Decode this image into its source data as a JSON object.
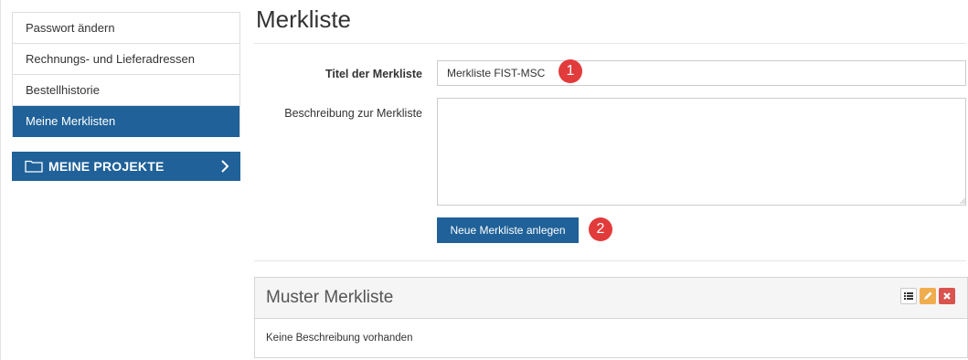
{
  "sidebar": {
    "items": [
      {
        "label": "Passwort ändern",
        "active": false
      },
      {
        "label": "Rechnungs- und Lieferadressen",
        "active": false
      },
      {
        "label": "Bestellhistorie",
        "active": false
      },
      {
        "label": "Meine Merklisten",
        "active": true
      }
    ],
    "projects_button": {
      "label": "MEINE PROJEKTE",
      "icon": "folder-icon",
      "chevron": "chevron-right-icon"
    }
  },
  "main": {
    "title": "Merkliste",
    "form": {
      "title_label": "Titel der Merkliste",
      "title_value": "Merkliste FIST-MSC",
      "description_label": "Beschreibung zur Merkliste",
      "description_value": "",
      "submit_label": "Neue Merkliste anlegen"
    },
    "markers": [
      "1",
      "2"
    ],
    "list_panel": {
      "title": "Muster Merkliste",
      "description": "Keine Beschreibung vorhanden",
      "tools": [
        "list-icon",
        "edit-icon",
        "delete-icon"
      ]
    }
  },
  "colors": {
    "primary": "#1f6198",
    "marker": "#e23b3b",
    "edit": "#f0ad4e",
    "delete": "#d9534f"
  }
}
